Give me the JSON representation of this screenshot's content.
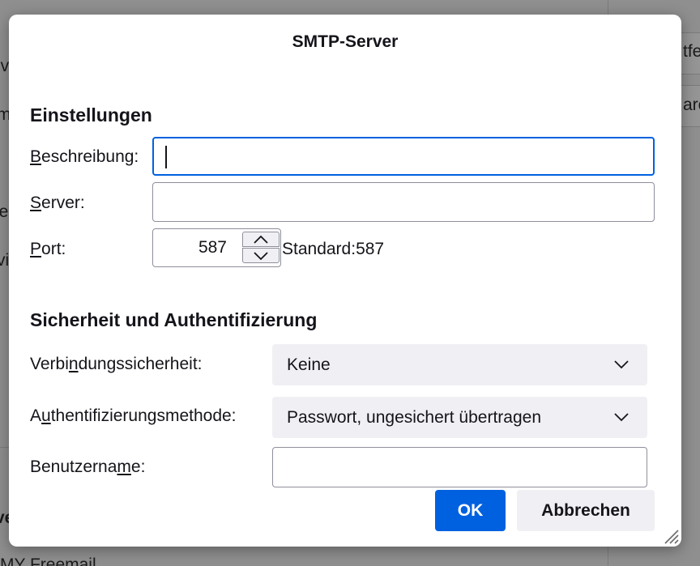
{
  "background": {
    "fragments": [
      {
        "text": "iv"
      },
      {
        "text": "m"
      },
      {
        "text": "le"
      },
      {
        "text": "vi"
      },
      {
        "text": "ve"
      },
      {
        "text": "MY Freemail"
      },
      {
        "text": "tfe"
      },
      {
        "text": "arc"
      }
    ]
  },
  "dialog": {
    "title": "SMTP-Server",
    "settings": {
      "heading": "Einstellungen",
      "description": {
        "label_pre": "",
        "label_mn": "B",
        "label_post": "eschreibung:",
        "value": ""
      },
      "server": {
        "label_pre": "",
        "label_mn": "S",
        "label_post": "erver:",
        "value": ""
      },
      "port": {
        "label_pre": "",
        "label_mn": "P",
        "label_post": "ort:",
        "value": "587",
        "default_text": "Standard:587"
      }
    },
    "security": {
      "heading": "Sicherheit und Authentifizierung",
      "connection": {
        "label_pre": "Verbi",
        "label_mn": "n",
        "label_post": "dungssicherheit:",
        "selected": "Keine"
      },
      "auth_method": {
        "label_pre": "A",
        "label_mn": "u",
        "label_post": "thentifizierungsmethode:",
        "selected": "Passwort, ungesichert übertragen"
      },
      "username": {
        "label_pre": "Benutzerna",
        "label_mn": "m",
        "label_post": "e:",
        "value": ""
      }
    },
    "buttons": {
      "ok": "OK",
      "cancel": "Abbrechen"
    }
  },
  "colors": {
    "accent": "#0061e0",
    "select_bg": "#f0f0f4",
    "text": "#15141a"
  },
  "icons": {
    "spin_up": "chevron-up-icon",
    "spin_down": "chevron-down-icon",
    "select_arrow": "chevron-down-icon",
    "resize": "resize-grip-icon"
  }
}
